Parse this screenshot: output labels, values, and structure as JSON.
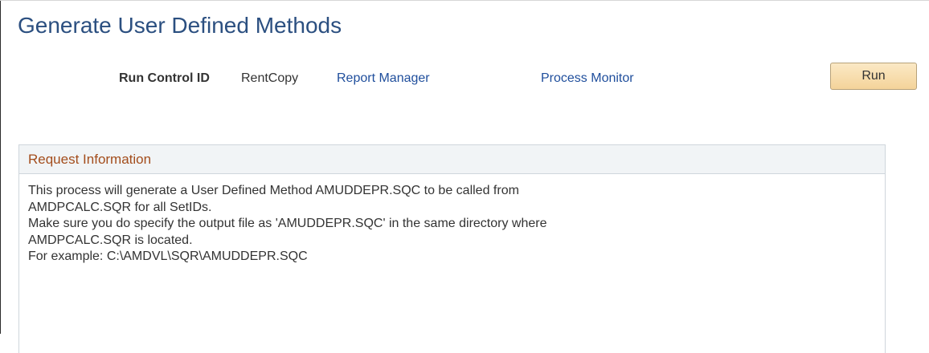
{
  "page": {
    "title": "Generate User Defined Methods"
  },
  "run_control": {
    "label": "Run Control ID",
    "value": "RentCopy"
  },
  "links": {
    "report_manager": "Report Manager",
    "process_monitor": "Process Monitor"
  },
  "actions": {
    "run_label": "Run"
  },
  "request_info": {
    "title": "Request Information",
    "lines": [
      "This process will generate a User Defined Method AMUDDEPR.SQC to be called from",
      "AMDPCALC.SQR for all SetIDs.",
      "Make sure you do specify the output file as 'AMUDDEPR.SQC' in the same directory where",
      "AMDPCALC.SQR is located.",
      "For example: C:\\AMDVL\\SQR\\AMUDDEPR.SQC"
    ]
  },
  "colors": {
    "title": "#2b4f80",
    "link": "#1f4e9c",
    "section_title": "#a34d1c",
    "button_fill": "#f4d39a",
    "section_header_bg": "#f1f4f6"
  }
}
